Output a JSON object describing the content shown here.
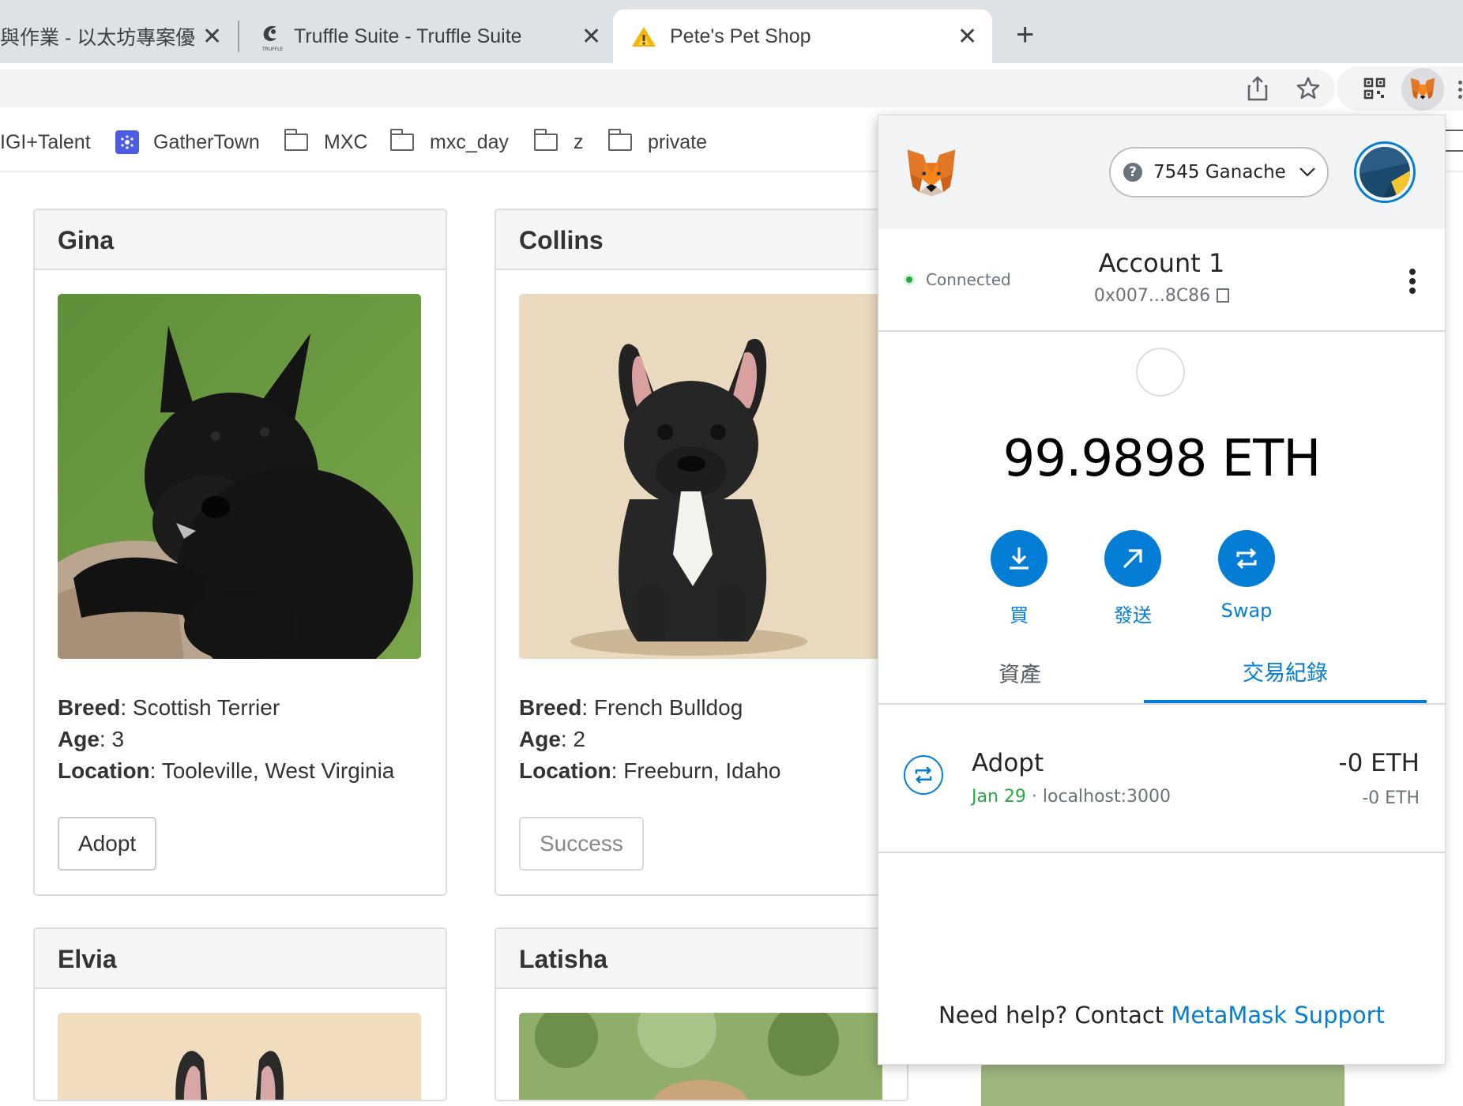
{
  "browser": {
    "tabs": [
      {
        "title": "與作業 - 以太坊專案優秀",
        "close": "✕"
      },
      {
        "title": "Truffle Suite - Truffle Suite",
        "close": "✕"
      },
      {
        "title": "Pete's Pet Shop",
        "close": "✕"
      }
    ],
    "new_tab": "+",
    "bookmarks": [
      {
        "label": "IGI+Talent"
      },
      {
        "label": "GatherTown"
      },
      {
        "label": "MXC"
      },
      {
        "label": "mxc_day"
      },
      {
        "label": "z"
      },
      {
        "label": "private"
      }
    ]
  },
  "pets": [
    {
      "name": "Gina",
      "breed_label": "Breed",
      "breed": ": Scottish Terrier",
      "age_label": "Age",
      "age": ": 3",
      "location_label": "Location",
      "location": ": Tooleville, West Virginia",
      "button": "Adopt"
    },
    {
      "name": "Collins",
      "breed_label": "Breed",
      "breed": ": French Bulldog",
      "age_label": "Age",
      "age": ": 2",
      "location_label": "Location",
      "location": ": Freeburn, Idaho",
      "button": "Success"
    },
    {
      "name": "Elvia"
    },
    {
      "name": "Latisha"
    }
  ],
  "metamask": {
    "network": "7545 Ganache",
    "network_icon": "?",
    "status": "Connected",
    "account_name": "Account 1",
    "account_address": "0x007...8C86",
    "balance": "99.9898 ETH",
    "actions": [
      {
        "label": "買",
        "icon": "download-icon"
      },
      {
        "label": "發送",
        "icon": "arrow-up-right-icon"
      },
      {
        "label": "Swap",
        "icon": "swap-icon"
      }
    ],
    "tabs": [
      {
        "label": "資產",
        "active": false
      },
      {
        "label": "交易紀錄",
        "active": true
      }
    ],
    "transaction": {
      "title": "Adopt",
      "date": "Jan 29",
      "separator": " · ",
      "origin": "localhost:3000",
      "amount": "-0 ETH",
      "amount_secondary": "-0 ETH"
    },
    "help_text": "Need help? Contact ",
    "help_link": "MetaMask Support",
    "accent_color": "#037dd6"
  }
}
